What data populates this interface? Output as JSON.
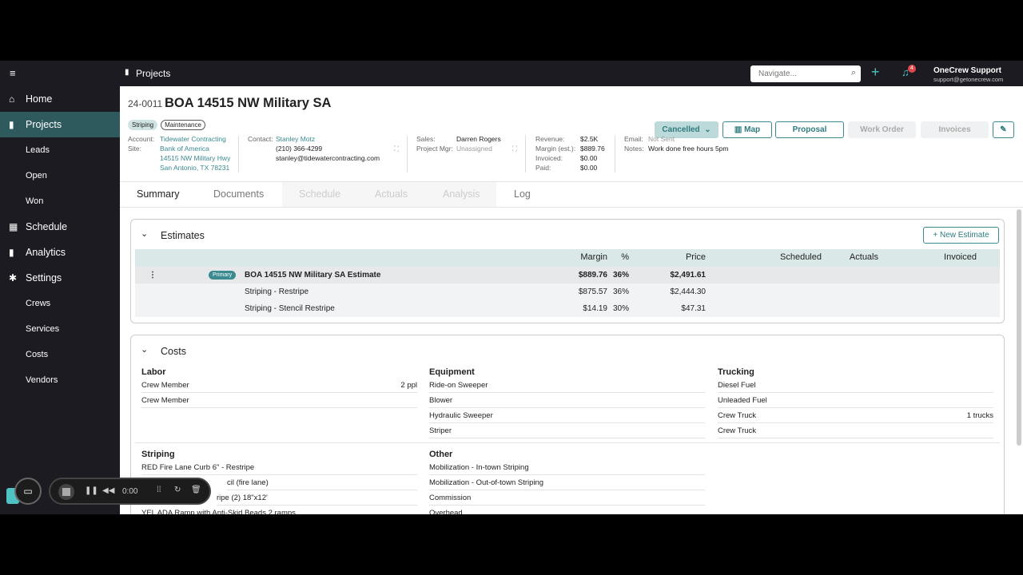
{
  "sidebar": {
    "items": [
      {
        "label": "Home",
        "icon": "home-icon",
        "type": "top"
      },
      {
        "label": "Projects",
        "icon": "clipboard-icon",
        "type": "top",
        "active": true
      },
      {
        "label": "Leads",
        "type": "sub"
      },
      {
        "label": "Open",
        "type": "sub"
      },
      {
        "label": "Won",
        "type": "sub"
      },
      {
        "label": "Schedule",
        "icon": "calendar-icon",
        "type": "top"
      },
      {
        "label": "Analytics",
        "icon": "bar-chart-icon",
        "type": "top"
      },
      {
        "label": "Settings",
        "icon": "gear-icon",
        "type": "top"
      },
      {
        "label": "Crews",
        "type": "sub"
      },
      {
        "label": "Services",
        "type": "sub"
      },
      {
        "label": "Costs",
        "type": "sub"
      },
      {
        "label": "Vendors",
        "type": "sub"
      }
    ]
  },
  "topbar": {
    "section": "Projects",
    "search_placeholder": "Navigate...",
    "notif_count": "4",
    "user_name": "OneCrew Support",
    "user_email": "support@getonecrew.com"
  },
  "project": {
    "number": "24-0011",
    "title": "BOA 14515 NW Military SA",
    "tags": [
      "Striping",
      "Maintenance"
    ],
    "status": "Cancelled",
    "buttons": {
      "map": "Map",
      "proposal": "Proposal",
      "work_order": "Work Order",
      "invoices": "Invoices"
    },
    "account_label": "Account:",
    "account": "Tidewater Contracting",
    "site_label": "Site:",
    "site": "Bank of America",
    "site_addr1": "14515 NW Military Hwy",
    "site_addr2": "San Antonio, TX 78231",
    "contact_label": "Contact:",
    "contact": "Stanley Motz",
    "phone": "(210) 366-4299",
    "email_addr": "stanley@tidewatercontracting.com",
    "sales_label": "Sales:",
    "sales": "Darren Rogers",
    "pm_label": "Project Mgr:",
    "pm": "Unassigned",
    "revenue_label": "Revenue:",
    "revenue": "$2.5K",
    "margin_label": "Margin (est.):",
    "margin": "$889.76",
    "invoiced_label": "Invoiced:",
    "invoiced": "$0.00",
    "paid_label": "Paid:",
    "paid": "$0.00",
    "email_label": "Email:",
    "email_status": "Not Sent",
    "notes_label": "Notes:",
    "notes": "Work done free hours 5pm"
  },
  "tabs": [
    "Summary",
    "Documents",
    "Schedule",
    "Actuals",
    "Analysis",
    "Log"
  ],
  "estimates": {
    "title": "Estimates",
    "new_button": "New Estimate",
    "columns": [
      "Margin",
      "%",
      "Price",
      "Scheduled",
      "Actuals",
      "Invoiced"
    ],
    "primary_badge": "Primary",
    "rows": [
      {
        "name": "BOA 14515 NW Military SA Estimate",
        "margin": "$889.76",
        "pct": "36%",
        "price": "$2,491.61"
      },
      {
        "name": "Striping - Restripe",
        "margin": "$875.57",
        "pct": "36%",
        "price": "$2,444.30"
      },
      {
        "name": "Striping - Stencil Restripe",
        "margin": "$14.19",
        "pct": "30%",
        "price": "$47.31"
      }
    ]
  },
  "costs": {
    "title": "Costs",
    "labor": {
      "title": "Labor",
      "items": [
        {
          "name": "Crew Member",
          "qty": "2 ppl"
        },
        {
          "name": "Crew Member",
          "qty": ""
        }
      ]
    },
    "equipment": {
      "title": "Equipment",
      "items": [
        "Ride-on Sweeper",
        "Blower",
        "Hydraulic Sweeper",
        "Striper"
      ]
    },
    "trucking": {
      "title": "Trucking",
      "items": [
        {
          "name": "Diesel Fuel",
          "qty": ""
        },
        {
          "name": "Unleaded Fuel",
          "qty": ""
        },
        {
          "name": "Crew Truck",
          "qty": "1 trucks"
        },
        {
          "name": "Crew Truck",
          "qty": ""
        }
      ]
    },
    "striping": {
      "title": "Striping",
      "items": [
        "RED Fire Lane Curb 6\" - Restripe",
        "cil (fire lane)",
        "ripe (2) 18\"x12'",
        "YEL ADA Ramp with Anti-Skid Beads 2 ramps"
      ]
    },
    "other": {
      "title": "Other",
      "items": [
        "Mobilization - In-town Striping",
        "Mobilization - Out-of-town Striping",
        "Commission",
        "Overhead"
      ]
    }
  },
  "recorder": {
    "time": "0:00"
  }
}
